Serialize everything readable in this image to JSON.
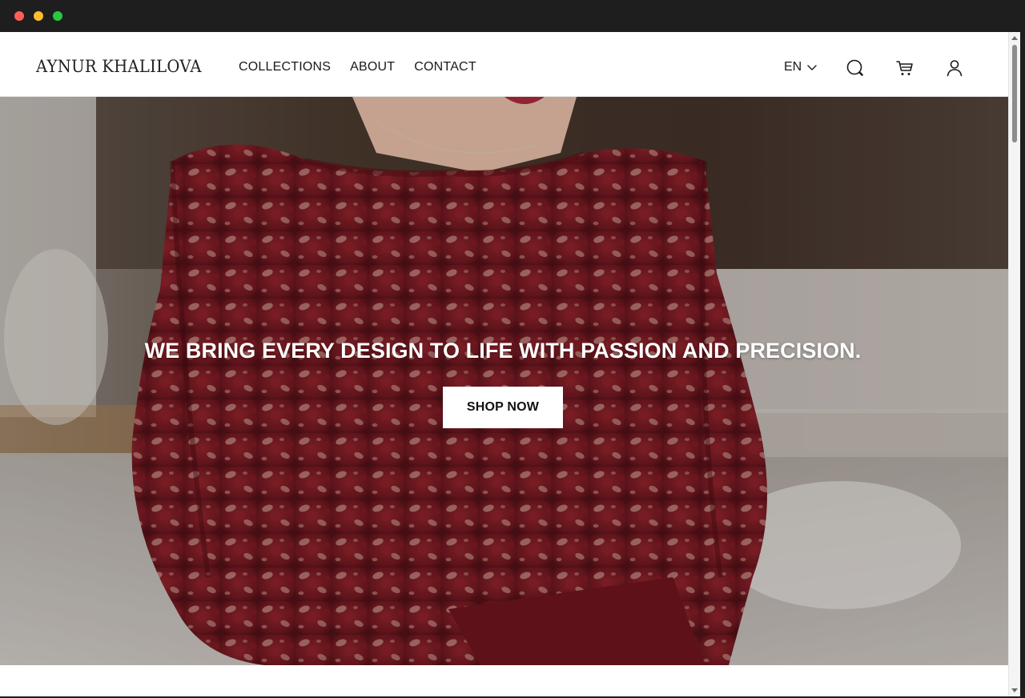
{
  "site": {
    "brand": "AYNUR KHALILOVA"
  },
  "nav": {
    "items": [
      {
        "label": "COLLECTIONS"
      },
      {
        "label": "ABOUT"
      },
      {
        "label": "CONTACT"
      }
    ]
  },
  "header": {
    "language": "EN",
    "icons": [
      "search-icon",
      "cart-icon",
      "account-icon",
      "chevron-down-icon"
    ]
  },
  "hero": {
    "headline": "WE BRING EVERY DESIGN TO LIFE WITH PASSION AND PRECISION.",
    "cta_label": "SHOP NOW"
  },
  "colors": {
    "window_chrome": "#1e1e1e",
    "traffic_close": "#ff5f57",
    "traffic_minimize": "#febc2e",
    "traffic_zoom": "#28c840",
    "dress": "#7a1a22",
    "text_dark": "#1a1a1a",
    "button_bg": "#ffffff"
  }
}
